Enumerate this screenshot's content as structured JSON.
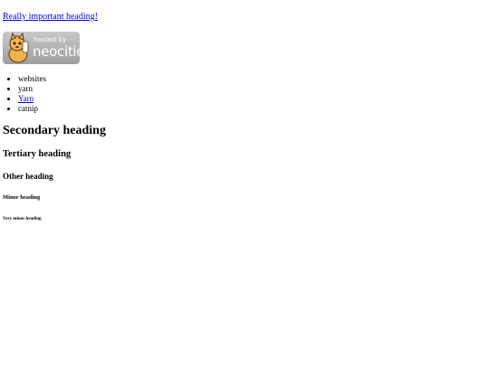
{
  "top_link": {
    "text": "Really important heading!"
  },
  "badge": {
    "line1": "hosted by",
    "line2": "neocities",
    "icon": "neocities-cat-mascot"
  },
  "list": {
    "items": [
      {
        "text": "websites",
        "link": false
      },
      {
        "text": "yarn",
        "link": false
      },
      {
        "text": "Yarn",
        "link": true
      },
      {
        "text": "catnip",
        "link": false
      }
    ]
  },
  "headings": {
    "secondary": "Secondary heading",
    "tertiary": "Tertiary heading",
    "other": "Other heading",
    "minor": "Minor heading",
    "very_minor": "Very minor heading"
  },
  "colors": {
    "link": "#0000ee",
    "badge_bg": "#aaaaaa"
  }
}
